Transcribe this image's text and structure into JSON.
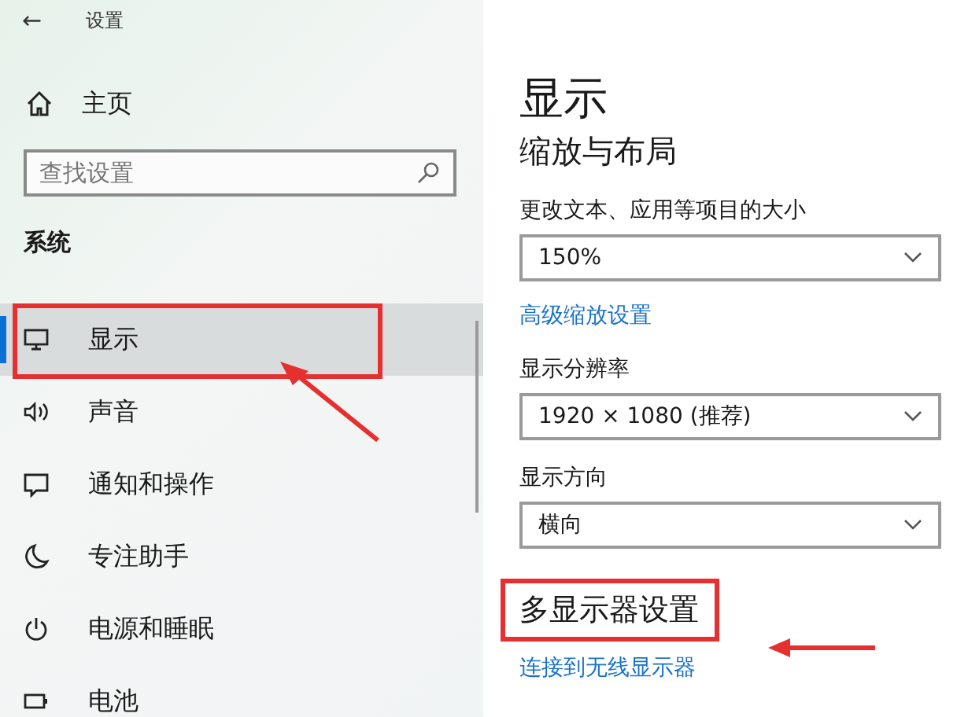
{
  "window": {
    "title": "设置",
    "back": "←"
  },
  "sidebar": {
    "home": "主页",
    "search": {
      "placeholder": "查找设置"
    },
    "group": "系统",
    "items": [
      {
        "label": "显示",
        "selected": true,
        "annotated": true
      },
      {
        "label": "声音",
        "selected": false,
        "annotated": false
      },
      {
        "label": "通知和操作",
        "selected": false,
        "annotated": false
      },
      {
        "label": "专注助手",
        "selected": false,
        "annotated": false
      },
      {
        "label": "电源和睡眠",
        "selected": false,
        "annotated": false
      },
      {
        "label": "电池",
        "selected": false,
        "annotated": false
      }
    ]
  },
  "content": {
    "title": "显示",
    "section": "缩放与布局",
    "settings": [
      {
        "kind": "dropdown",
        "label": "更改文本、应用等项目的大小",
        "value": "150%"
      },
      {
        "kind": "link",
        "label": "高级缩放设置"
      },
      {
        "kind": "dropdown",
        "label": "显示分辨率",
        "value": "1920 × 1080 (推荐)"
      },
      {
        "kind": "dropdown",
        "label": "显示方向",
        "value": "横向"
      },
      {
        "kind": "heading",
        "label": "多显示器设置",
        "annotated": true
      },
      {
        "kind": "link",
        "label": "连接到无线显示器"
      }
    ]
  }
}
